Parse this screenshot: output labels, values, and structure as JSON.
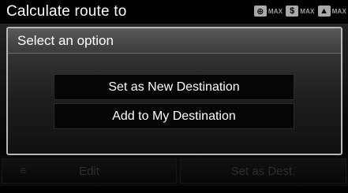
{
  "header": {
    "title": "Calculate route to",
    "status": [
      {
        "icon": "toll-road-icon",
        "glyph": "⊕",
        "label": "MAX"
      },
      {
        "icon": "dollar-icon",
        "glyph": "$",
        "label": "MAX"
      },
      {
        "icon": "ferry-icon",
        "glyph": "▲",
        "label": "MAX"
      }
    ]
  },
  "dialog": {
    "title": "Select an option",
    "options": [
      {
        "label": "Set as New Destination"
      },
      {
        "label": "Add to My Destination"
      }
    ]
  },
  "bottom_bar": {
    "left_label": "Edit",
    "right_label": "Set as Dest."
  }
}
